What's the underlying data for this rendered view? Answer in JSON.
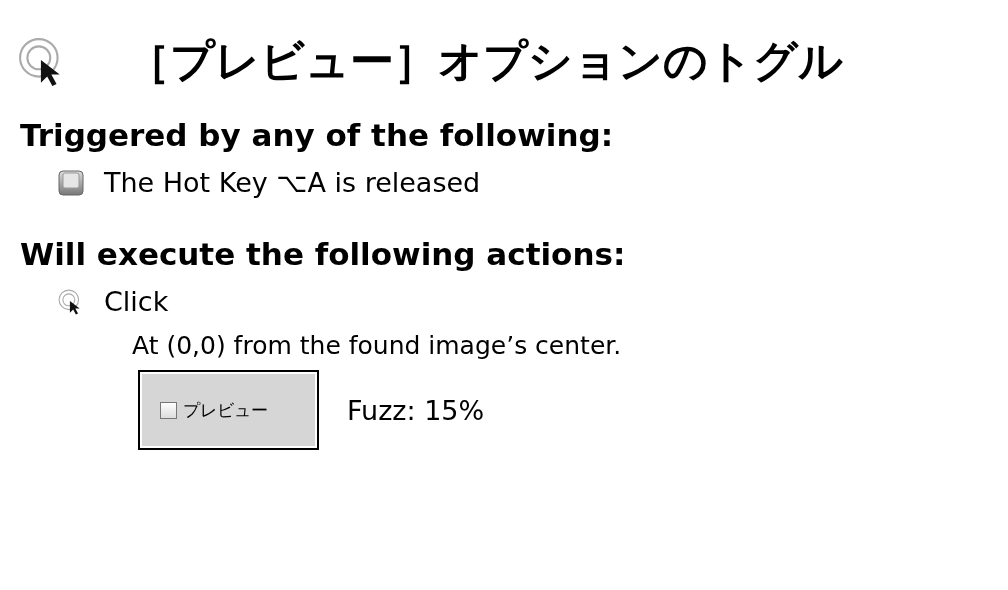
{
  "title": "［プレビュー］オプションのトグル",
  "triggers": {
    "heading": "Triggered by any of the following:",
    "items": [
      {
        "kind": "hotkey",
        "label": "The Hot Key ⌥A is released"
      }
    ]
  },
  "actions": {
    "heading": "Will execute the following actions:",
    "items": [
      {
        "kind": "click",
        "label": "Click",
        "detail": "At (0,0) from the found image’s center.",
        "image": {
          "checkbox_label": "プレビュー",
          "checked": false
        },
        "fuzz": "Fuzz: 15%"
      }
    ]
  }
}
